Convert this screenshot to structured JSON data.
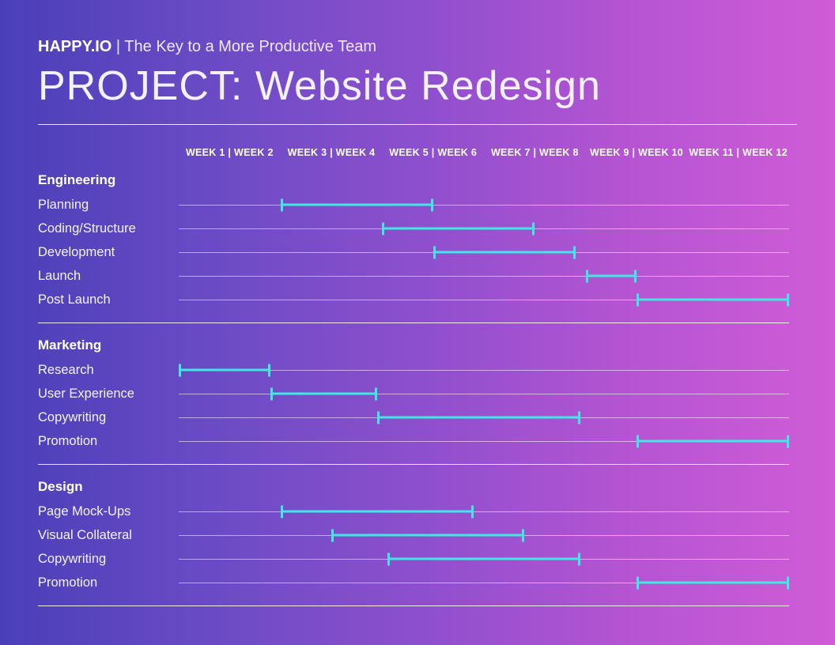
{
  "header": {
    "brand": "HAPPY.IO",
    "tagline": " | The Key to a More Productive Team"
  },
  "project_label": "PROJECT: ",
  "project_name": "Website Redesign",
  "timeline_labels": [
    "WEEK 1 | WEEK 2",
    "WEEK 3 | WEEK 4",
    "WEEK 5 | WEEK 6",
    "WEEK 7 | WEEK 8",
    "WEEK 9 | WEEK 10",
    "WEEK 11 | WEEK 12"
  ],
  "chart_data": {
    "type": "bar",
    "x_unit": "week",
    "x_range": [
      1,
      12
    ],
    "title": "PROJECT: Website Redesign",
    "bar_color": "#3fe8e0",
    "groups": [
      {
        "name": "Engineering",
        "tasks": [
          {
            "label": "Planning",
            "start": 3.0,
            "end": 6.0
          },
          {
            "label": "Coding/Structure",
            "start": 5.0,
            "end": 8.0
          },
          {
            "label": "Development",
            "start": 6.0,
            "end": 8.8
          },
          {
            "label": "Launch",
            "start": 9.0,
            "end": 10.0
          },
          {
            "label": "Post Launch",
            "start": 10.0,
            "end": 13.0
          }
        ]
      },
      {
        "name": "Marketing",
        "tasks": [
          {
            "label": "Research",
            "start": 1.0,
            "end": 2.8
          },
          {
            "label": "User Experience",
            "start": 2.8,
            "end": 4.9
          },
          {
            "label": "Copywriting",
            "start": 4.9,
            "end": 8.9
          },
          {
            "label": "Promotion",
            "start": 10.0,
            "end": 13.0
          }
        ]
      },
      {
        "name": "Design",
        "tasks": [
          {
            "label": "Page Mock-Ups",
            "start": 3.0,
            "end": 6.8
          },
          {
            "label": "Visual Collateral",
            "start": 4.0,
            "end": 7.8
          },
          {
            "label": "Copywriting",
            "start": 5.1,
            "end": 8.9
          },
          {
            "label": "Promotion",
            "start": 10.0,
            "end": 13.0
          }
        ]
      }
    ]
  }
}
